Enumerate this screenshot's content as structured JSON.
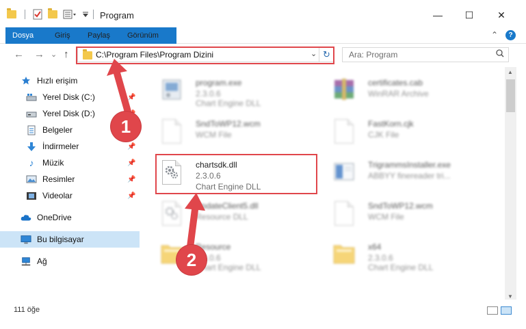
{
  "window": {
    "title": "Program",
    "minimize_glyph": "—",
    "maximize_glyph": "☐",
    "close_glyph": "✕"
  },
  "ribbon": {
    "tabs": [
      "Dosya",
      "Giriş",
      "Paylaş",
      "Görünüm"
    ],
    "expand_glyph": "⌃",
    "help_glyph": "?"
  },
  "nav": {
    "back_glyph": "←",
    "forward_glyph": "→",
    "recent_glyph": "⌄",
    "up_glyph": "↑",
    "address": "C:\\Program Files\\Program Dizini",
    "address_chevron": "⌄",
    "refresh_glyph": "↻",
    "search_placeholder": "Ara: Program",
    "search_glyph": "⌕"
  },
  "sidebar": {
    "quick_access": "Hızlı erişim",
    "items": [
      {
        "label": "Yerel Disk (C:)",
        "icon": "drive-icon",
        "pinned": true
      },
      {
        "label": "Yerel Disk (D:)",
        "icon": "drive-icon",
        "pinned": true
      },
      {
        "label": "Belgeler",
        "icon": "documents-icon",
        "pinned": true
      },
      {
        "label": "İndirmeler",
        "icon": "downloads-icon",
        "pinned": true
      },
      {
        "label": "Müzik",
        "icon": "music-icon",
        "pinned": true
      },
      {
        "label": "Resimler",
        "icon": "pictures-icon",
        "pinned": true
      },
      {
        "label": "Videolar",
        "icon": "videos-icon",
        "pinned": true
      }
    ],
    "onedrive": "OneDrive",
    "this_pc": "Bu bilgisayar",
    "network": "Ağ"
  },
  "files": [
    {
      "name": "program.exe",
      "line1": "2.3.0.6",
      "line2": "Chart Engine DLL",
      "icon": "exe-icon",
      "blurred": true
    },
    {
      "name": "certificates.cab",
      "line1": "WinRAR Archive",
      "line2": "",
      "icon": "archive-icon",
      "blurred": true
    },
    {
      "name": "SndToWP12.wcm",
      "line1": "WCM File",
      "line2": "",
      "icon": "document-icon",
      "blurred": true
    },
    {
      "name": "FastKorn.cjk",
      "line1": "CJK File",
      "line2": "",
      "icon": "document-icon",
      "blurred": true
    },
    {
      "name": "chartsdk.dll",
      "line1": "2.3.0.6",
      "line2": "Chart Engine DLL",
      "icon": "dll-icon",
      "blurred": false
    },
    {
      "name": "TrigrammsInstaller.exe",
      "line1": "ABBYY finereader tri...",
      "line2": "",
      "icon": "installer-icon",
      "blurred": true
    },
    {
      "name": "UpdateClient5.dll",
      "line1": "Resource DLL",
      "line2": "",
      "icon": "dll-icon",
      "blurred": true
    },
    {
      "name": "SndToWP12.wcm",
      "line1": "WCM File",
      "line2": "",
      "icon": "document-icon",
      "blurred": true
    },
    {
      "name": "Resource",
      "line1": "2.3.0.6",
      "line2": "Chart Engine DLL",
      "icon": "folder-icon",
      "blurred": true
    },
    {
      "name": "x64",
      "line1": "2.3.0.6",
      "line2": "Chart Engine DLL",
      "icon": "folder-icon",
      "blurred": true
    }
  ],
  "status": {
    "count": "111 öğe"
  },
  "annotations": {
    "step1": "1",
    "step2": "2",
    "color": "#e0464b"
  },
  "colors": {
    "accent": "#1979ca",
    "selection": "#cce4f7",
    "folder": "#f3c84b"
  }
}
